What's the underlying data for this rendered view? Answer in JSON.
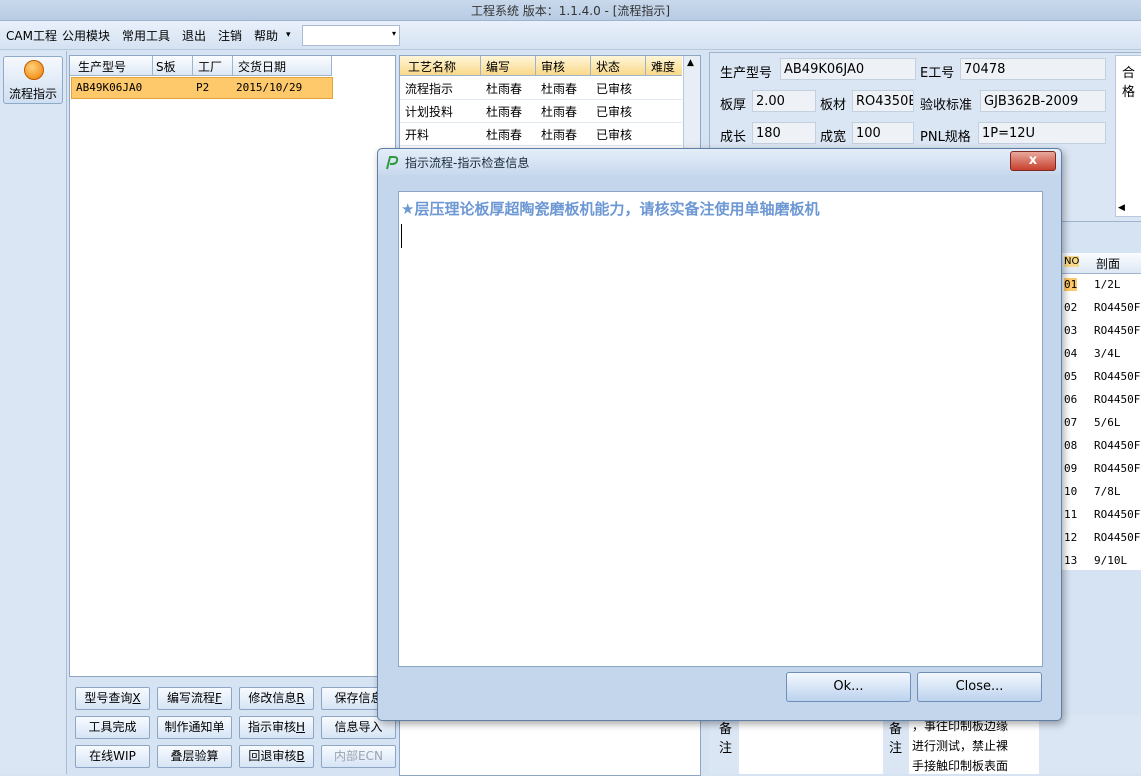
{
  "window": {
    "title": "工程系统   版本：1.1.4.0 - [流程指示]"
  },
  "menu": {
    "items": [
      "CAM工程",
      "公用模块",
      "常用工具",
      "退出",
      "注销",
      "帮助"
    ],
    "help_arrow": "▾",
    "combo_arrow": "▾"
  },
  "leftnav": {
    "button_label": "流程指示"
  },
  "orders": {
    "columns": [
      "生产型号",
      "S板",
      "工厂",
      "交货日期"
    ],
    "rows": [
      {
        "model": "AB49K06JA0",
        "s": "",
        "factory": "P2",
        "date": "2015/10/29"
      }
    ]
  },
  "process": {
    "columns": [
      "工艺名称",
      "编写",
      "审核",
      "状态",
      "难度"
    ],
    "rows": [
      {
        "name": "流程指示",
        "writer": "杜雨春",
        "reviewer": "杜雨春",
        "status": "已审核"
      },
      {
        "name": "计划投料",
        "writer": "杜雨春",
        "reviewer": "杜雨春",
        "status": "已审核"
      },
      {
        "name": "开料",
        "writer": "杜雨春",
        "reviewer": "杜雨春",
        "status": "已审核"
      }
    ]
  },
  "info": {
    "model_label": "生产型号",
    "model": "AB49K06JA0",
    "e_label": "E工号",
    "e_value": "70478",
    "thick_label": "板厚",
    "thick": "2.00",
    "mat_label": "板材",
    "mat": "RO4350E",
    "accept_label": "验收标准",
    "accept": "GJB362B-2009",
    "len_label": "成长",
    "len": "180",
    "wid_label": "成宽",
    "wid": "100",
    "pnl_label": "PNL规格",
    "pnl": "1P=12U",
    "right_label": "合格"
  },
  "layers": {
    "columns": [
      "NO",
      "剖面"
    ],
    "rows": [
      {
        "no": "01",
        "v": "1/2L"
      },
      {
        "no": "02",
        "v": "RO4450F"
      },
      {
        "no": "03",
        "v": "RO4450F"
      },
      {
        "no": "04",
        "v": "3/4L"
      },
      {
        "no": "05",
        "v": "RO4450F"
      },
      {
        "no": "06",
        "v": "RO4450F"
      },
      {
        "no": "07",
        "v": "5/6L"
      },
      {
        "no": "08",
        "v": "RO4450F"
      },
      {
        "no": "09",
        "v": "RO4450F"
      },
      {
        "no": "10",
        "v": "7/8L"
      },
      {
        "no": "11",
        "v": "RO4450F"
      },
      {
        "no": "12",
        "v": "RO4450F"
      },
      {
        "no": "13",
        "v": "9/10L"
      }
    ]
  },
  "notes": {
    "label_a": "备",
    "label_b": "注",
    "text_line1": "，事往印制板边缘",
    "text_line2": "进行测试，禁止裸",
    "text_line3": "手接触印制板表面"
  },
  "buttons": {
    "model_query": "型号查询",
    "model_query_key": "X",
    "write_flow": "编写流程",
    "write_flow_key": "F",
    "modify_info": "修改信息",
    "modify_info_key": "R",
    "save_info": "保存信息",
    "tool_done": "工具完成",
    "make_notice": "制作通知单",
    "indicate_review": "指示审核",
    "indicate_review_key": "H",
    "info_import": "信息导入",
    "online_wip": "在线WIP",
    "stack_check": "叠层验算",
    "revert_review": "回退审核",
    "revert_review_key": "B",
    "internal_ecn": "内部ECN"
  },
  "dialog": {
    "title": "指示流程-指示检查信息",
    "message": "★层压理论板厚超陶瓷磨板机能力，请核实备注使用单轴磨板机",
    "ok": "Ok...",
    "close": "Close...",
    "close_x": "x"
  },
  "colors": {
    "selected_row": "#fdc96a",
    "dialog_msg": "#6d98d4",
    "close_red": "#c7402e"
  }
}
